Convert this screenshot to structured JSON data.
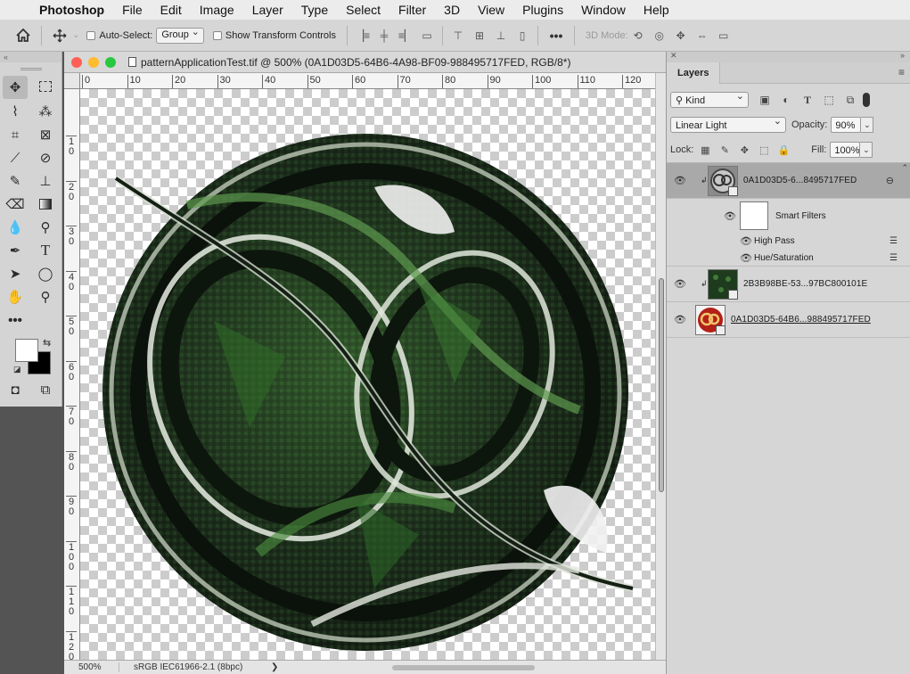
{
  "menubar": {
    "app": "Photoshop",
    "items": [
      "File",
      "Edit",
      "Image",
      "Layer",
      "Type",
      "Select",
      "Filter",
      "3D",
      "View",
      "Plugins",
      "Window",
      "Help"
    ]
  },
  "options": {
    "auto_select_label": "Auto-Select:",
    "auto_select_value": "Group",
    "show_transform_label": "Show Transform Controls",
    "three_d_mode_label": "3D Mode:"
  },
  "document": {
    "title": "patternApplicationTest.tif @ 500% (0A1D03D5-64B6-4A98-BF09-988495717FED, RGB/8*)",
    "zoom": "500%",
    "color_profile": "sRGB IEC61966-2.1 (8bpc)",
    "status_arrow": "❯",
    "h_ruler": [
      "0",
      "10",
      "20",
      "30",
      "40",
      "50",
      "60",
      "70",
      "80",
      "90",
      "100",
      "110",
      "120"
    ],
    "v_ruler": [
      "1\n0",
      "2\n0",
      "3\n0",
      "4\n0",
      "5\n0",
      "6\n0",
      "7\n0",
      "8\n0",
      "9\n0",
      "1\n0\n0",
      "1\n1\n0",
      "1\n2\n0"
    ]
  },
  "layers_panel": {
    "tab": "Layers",
    "filter_kind": "Kind",
    "blend_mode": "Linear Light",
    "opacity_label": "Opacity:",
    "opacity_value": "90%",
    "lock_label": "Lock:",
    "fill_label": "Fill:",
    "fill_value": "100%",
    "layers": [
      {
        "name": "0A1D03D5-6...8495717FED",
        "selected": true,
        "clipped": true
      },
      {
        "name": "2B3B98BE-53...97BC800101E",
        "selected": false,
        "clipped": true
      },
      {
        "name": "0A1D03D5-64B6...988495717FED",
        "selected": false,
        "clipped": false
      }
    ],
    "smart_filters_label": "Smart Filters",
    "filters": [
      "High Pass",
      "Hue/Saturation"
    ]
  },
  "colors": {
    "foreground": "#ffffff",
    "background": "#000000"
  }
}
